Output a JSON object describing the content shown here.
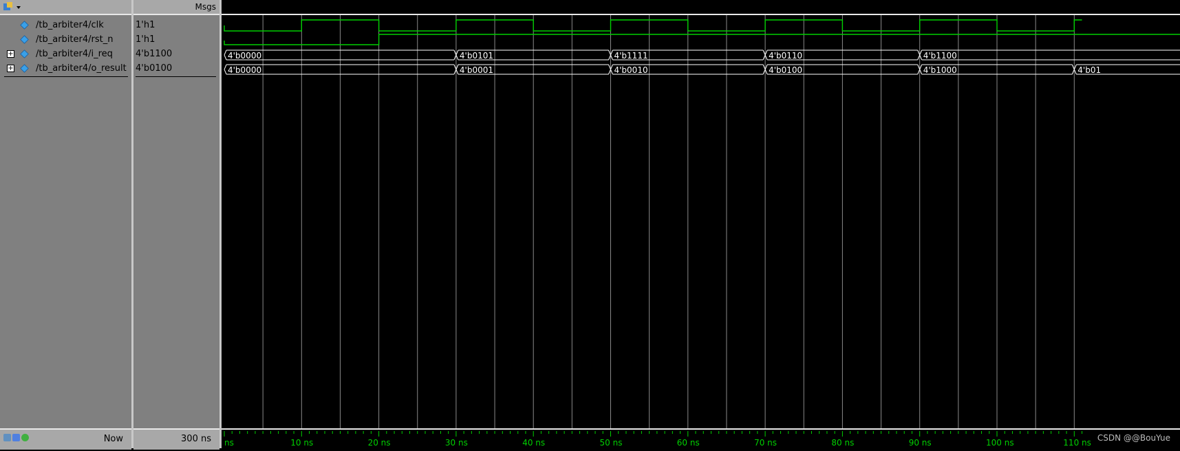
{
  "header": {
    "msgs_label": "Msgs"
  },
  "signals": [
    {
      "name": "/tb_arbiter4/clk",
      "value": "1'h1",
      "expandable": false
    },
    {
      "name": "/tb_arbiter4/rst_n",
      "value": "1'h1",
      "expandable": false
    },
    {
      "name": "/tb_arbiter4/i_req",
      "value": "4'b1100",
      "expandable": true
    },
    {
      "name": "/tb_arbiter4/o_result",
      "value": "4'b0100",
      "expandable": true
    }
  ],
  "buses": {
    "i_req": [
      {
        "t": 0,
        "v": "4'b0000"
      },
      {
        "t": 30,
        "v": "4'b0101"
      },
      {
        "t": 50,
        "v": "4'b1111"
      },
      {
        "t": 70,
        "v": "4'b0110"
      },
      {
        "t": 90,
        "v": "4'b1100"
      }
    ],
    "o_result": [
      {
        "t": 0,
        "v": "4'b0000"
      },
      {
        "t": 30,
        "v": "4'b0001"
      },
      {
        "t": 50,
        "v": "4'b0010"
      },
      {
        "t": 70,
        "v": "4'b0100"
      },
      {
        "t": 90,
        "v": "4'b1000"
      },
      {
        "t": 110,
        "v": "4'b01"
      }
    ]
  },
  "rst_release_ns": 20,
  "clk_period_ns": 20,
  "timeline": {
    "labels": [
      "ns",
      "10 ns",
      "20 ns",
      "30 ns",
      "40 ns",
      "50 ns",
      "60 ns",
      "70 ns",
      "80 ns",
      "90 ns",
      "100 ns",
      "110 ns"
    ],
    "view_start_ns": 0,
    "view_end_ns": 111
  },
  "footer": {
    "now_label": "Now",
    "now_value": "300 ns"
  },
  "watermark": "CSDN @@BouYue",
  "colors": {
    "wave": "#00d000",
    "grid": "#8a8a8a",
    "bg": "#000000",
    "panel": "#808080",
    "diamond": "#3aa0e8"
  }
}
